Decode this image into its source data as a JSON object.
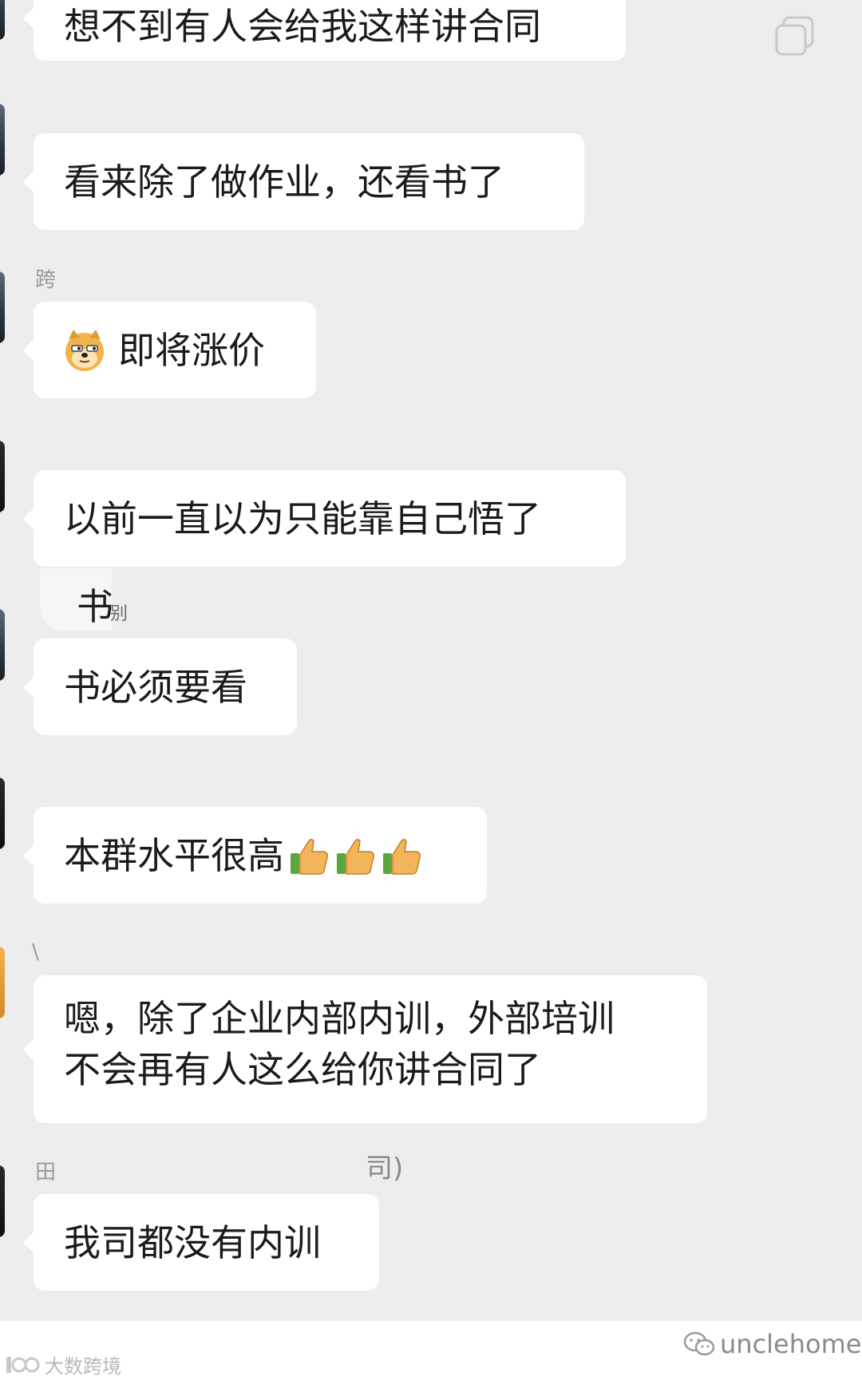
{
  "messages": [
    {
      "sender_nick": "",
      "text": "想不到有人会给我这样讲合同"
    },
    {
      "sender_nick": "",
      "text": "看来除了做作业，还看书了"
    },
    {
      "sender_nick": "跨",
      "text": "即将涨价",
      "emoji": "doge-emoji"
    },
    {
      "sender_nick": "",
      "text": "以前一直以为只能靠自己悟了"
    },
    {
      "sender_nick": "",
      "text": "书必须要看",
      "quote_text": "书",
      "quote_suffix": "别"
    },
    {
      "sender_nick": "",
      "text": "本群水平很高",
      "emoji": "thumbs-up-emoji",
      "emoji_count": 3
    },
    {
      "sender_nick": "\\",
      "lines": [
        "嗯，除了企业内部内训，外部培训",
        "不会再有人这么给你讲合同了"
      ]
    },
    {
      "sender_nick": "田",
      "sender_nick_end": "司)",
      "text": "我司都没有内训"
    }
  ],
  "watermarks": {
    "left": "大数跨境",
    "right": "unclehome"
  },
  "colors": {
    "chat_background": "#ededed",
    "bubble": "#ffffff",
    "text": "#1b1b1b",
    "muted": "#9a9a9a"
  }
}
